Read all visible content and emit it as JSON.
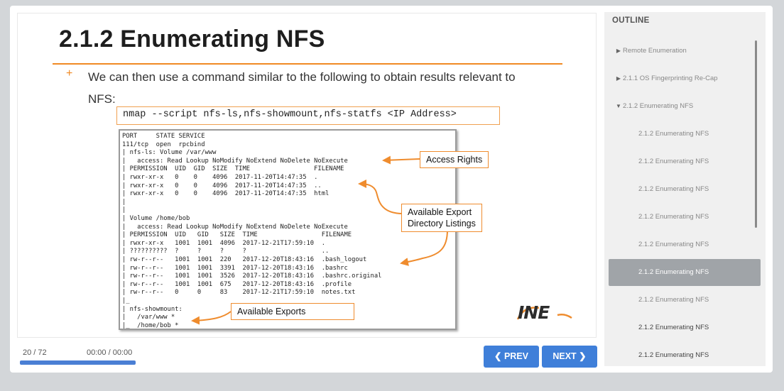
{
  "slide": {
    "title": "2.1.2 Enumerating NFS",
    "bullet_marker": "+",
    "bullet_line1": "We can then use a command similar to the following to obtain results relevant to",
    "bullet_line2": "NFS:",
    "command": "nmap --script nfs-ls,nfs-showmount,nfs-statfs <IP Address>",
    "terminal_lines": [
      "PORT     STATE SERVICE",
      "111/tcp  open  rpcbind",
      "| nfs-ls: Volume /var/www",
      "|   access: Read Lookup NoModify NoExtend NoDelete NoExecute",
      "| PERMISSION  UID  GID  SIZE  TIME                 FILENAME",
      "| rwxr-xr-x   0    0    4096  2017-11-20T14:47:35  .",
      "| rwxr-xr-x   0    0    4096  2017-11-20T14:47:35  ..",
      "| rwxr-xr-x   0    0    4096  2017-11-20T14:47:35  html",
      "|",
      "|",
      "| Volume /home/bob",
      "|   access: Read Lookup NoModify NoExtend NoDelete NoExecute",
      "| PERMISSION  UID   GID   SIZE  TIME                 FILENAME",
      "| rwxr-xr-x   1001  1001  4096  2017-12-21T17:59:10  .",
      "| ??????????  ?     ?     ?     ?                    ..",
      "| rw-r--r--   1001  1001  220   2017-12-20T18:43:16  .bash_logout",
      "| rw-r--r--   1001  1001  3391  2017-12-20T18:43:16  .bashrc",
      "| rw-r--r--   1001  1001  3526  2017-12-20T18:43:16  .bashrc.original",
      "| rw-r--r--   1001  1001  675   2017-12-20T18:43:16  .profile",
      "| rw-r--r--   0     0     83    2017-12-21T17:59:10  notes.txt",
      "|_",
      "| nfs-showmount:",
      "|   /var/www *",
      "|_  /home/bob *"
    ],
    "callouts": {
      "access_rights": "Access Rights",
      "export_listings_1": "Available Export",
      "export_listings_2": "Directory Listings",
      "available_exports": "Available Exports"
    },
    "logo_text": "INE"
  },
  "player": {
    "counter": "20 / 72",
    "time": "00:00 / 00:00",
    "progress": 1.0,
    "prev_label": "PREV",
    "next_label": "NEXT"
  },
  "outline": {
    "title": "OUTLINE",
    "items": [
      {
        "label": "Remote Enumeration",
        "level": "top",
        "caret": "right"
      },
      {
        "label": "2.1.1 OS Fingerprinting Re-Cap",
        "level": "top",
        "caret": "right"
      },
      {
        "label": "2.1.2 Enumerating NFS",
        "level": "top",
        "caret": "down"
      },
      {
        "label": "2.1.2 Enumerating NFS",
        "level": "sub"
      },
      {
        "label": "2.1.2 Enumerating NFS",
        "level": "sub"
      },
      {
        "label": "2.1.2 Enumerating NFS",
        "level": "sub"
      },
      {
        "label": "2.1.2 Enumerating NFS",
        "level": "sub"
      },
      {
        "label": "2.1.2 Enumerating NFS",
        "level": "sub"
      },
      {
        "label": "2.1.2 Enumerating NFS",
        "level": "sub",
        "active": true
      },
      {
        "label": "2.1.2 Enumerating NFS",
        "level": "sub"
      },
      {
        "label": "2.1.2 Enumerating NFS",
        "level": "sub"
      },
      {
        "label": "2.1.2 Enumerating NFS",
        "level": "sub"
      }
    ]
  },
  "colors": {
    "accent_orange": "#f08a24",
    "button_blue": "#3f7fd9",
    "active_item_grey": "#a0a4a8"
  }
}
